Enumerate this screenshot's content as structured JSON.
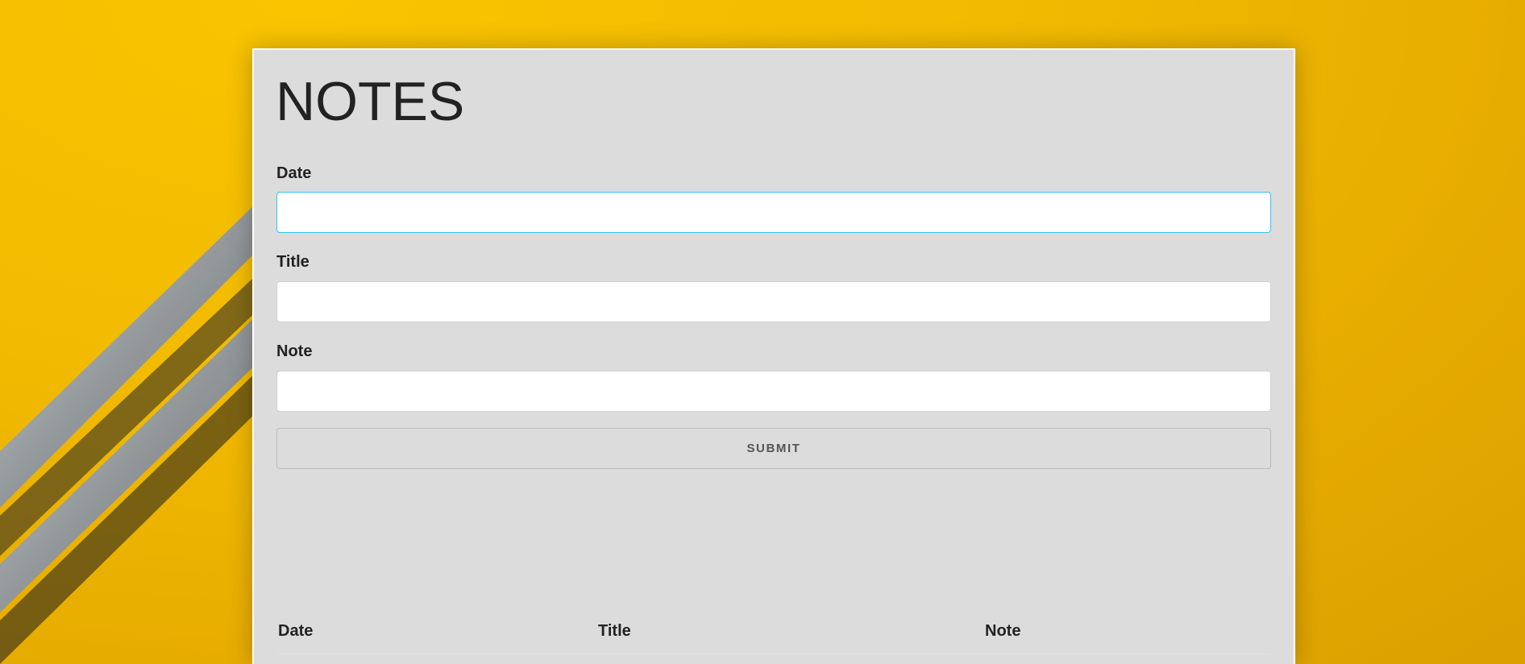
{
  "page": {
    "title": "NOTES"
  },
  "form": {
    "date_label": "Date",
    "date_value": "",
    "title_label": "Title",
    "title_value": "",
    "note_label": "Note",
    "note_value": "",
    "submit_label": "SUBMIT"
  },
  "table": {
    "columns": [
      "Date",
      "Title",
      "Note"
    ],
    "rows": []
  },
  "colors": {
    "background_accent": "#f2bb00",
    "card_background": "#dcdcdc",
    "focus_border": "#33c3f0"
  }
}
